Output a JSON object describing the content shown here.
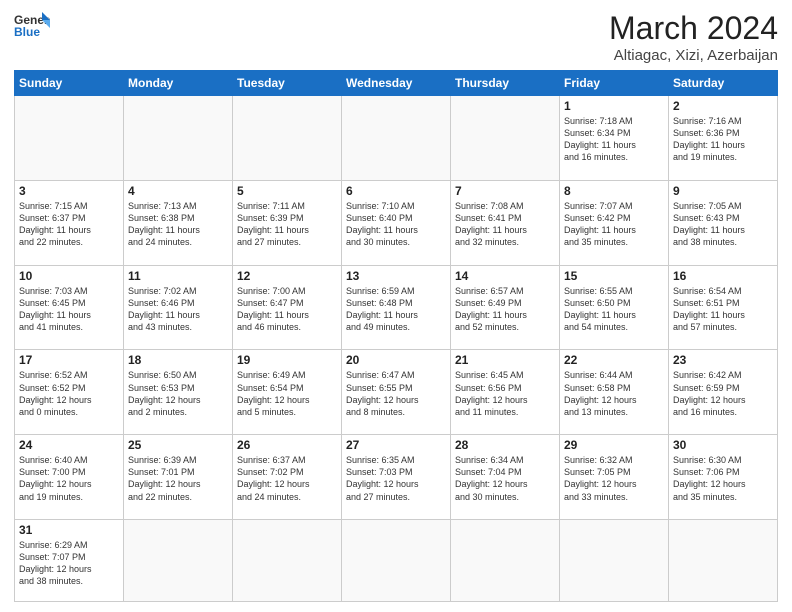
{
  "header": {
    "logo_general": "General",
    "logo_blue": "Blue",
    "title": "March 2024",
    "location": "Altiagac, Xizi, Azerbaijan"
  },
  "weekdays": [
    "Sunday",
    "Monday",
    "Tuesday",
    "Wednesday",
    "Thursday",
    "Friday",
    "Saturday"
  ],
  "weeks": [
    [
      {
        "day": "",
        "info": ""
      },
      {
        "day": "",
        "info": ""
      },
      {
        "day": "",
        "info": ""
      },
      {
        "day": "",
        "info": ""
      },
      {
        "day": "",
        "info": ""
      },
      {
        "day": "1",
        "info": "Sunrise: 7:18 AM\nSunset: 6:34 PM\nDaylight: 11 hours\nand 16 minutes."
      },
      {
        "day": "2",
        "info": "Sunrise: 7:16 AM\nSunset: 6:36 PM\nDaylight: 11 hours\nand 19 minutes."
      }
    ],
    [
      {
        "day": "3",
        "info": "Sunrise: 7:15 AM\nSunset: 6:37 PM\nDaylight: 11 hours\nand 22 minutes."
      },
      {
        "day": "4",
        "info": "Sunrise: 7:13 AM\nSunset: 6:38 PM\nDaylight: 11 hours\nand 24 minutes."
      },
      {
        "day": "5",
        "info": "Sunrise: 7:11 AM\nSunset: 6:39 PM\nDaylight: 11 hours\nand 27 minutes."
      },
      {
        "day": "6",
        "info": "Sunrise: 7:10 AM\nSunset: 6:40 PM\nDaylight: 11 hours\nand 30 minutes."
      },
      {
        "day": "7",
        "info": "Sunrise: 7:08 AM\nSunset: 6:41 PM\nDaylight: 11 hours\nand 32 minutes."
      },
      {
        "day": "8",
        "info": "Sunrise: 7:07 AM\nSunset: 6:42 PM\nDaylight: 11 hours\nand 35 minutes."
      },
      {
        "day": "9",
        "info": "Sunrise: 7:05 AM\nSunset: 6:43 PM\nDaylight: 11 hours\nand 38 minutes."
      }
    ],
    [
      {
        "day": "10",
        "info": "Sunrise: 7:03 AM\nSunset: 6:45 PM\nDaylight: 11 hours\nand 41 minutes."
      },
      {
        "day": "11",
        "info": "Sunrise: 7:02 AM\nSunset: 6:46 PM\nDaylight: 11 hours\nand 43 minutes."
      },
      {
        "day": "12",
        "info": "Sunrise: 7:00 AM\nSunset: 6:47 PM\nDaylight: 11 hours\nand 46 minutes."
      },
      {
        "day": "13",
        "info": "Sunrise: 6:59 AM\nSunset: 6:48 PM\nDaylight: 11 hours\nand 49 minutes."
      },
      {
        "day": "14",
        "info": "Sunrise: 6:57 AM\nSunset: 6:49 PM\nDaylight: 11 hours\nand 52 minutes."
      },
      {
        "day": "15",
        "info": "Sunrise: 6:55 AM\nSunset: 6:50 PM\nDaylight: 11 hours\nand 54 minutes."
      },
      {
        "day": "16",
        "info": "Sunrise: 6:54 AM\nSunset: 6:51 PM\nDaylight: 11 hours\nand 57 minutes."
      }
    ],
    [
      {
        "day": "17",
        "info": "Sunrise: 6:52 AM\nSunset: 6:52 PM\nDaylight: 12 hours\nand 0 minutes."
      },
      {
        "day": "18",
        "info": "Sunrise: 6:50 AM\nSunset: 6:53 PM\nDaylight: 12 hours\nand 2 minutes."
      },
      {
        "day": "19",
        "info": "Sunrise: 6:49 AM\nSunset: 6:54 PM\nDaylight: 12 hours\nand 5 minutes."
      },
      {
        "day": "20",
        "info": "Sunrise: 6:47 AM\nSunset: 6:55 PM\nDaylight: 12 hours\nand 8 minutes."
      },
      {
        "day": "21",
        "info": "Sunrise: 6:45 AM\nSunset: 6:56 PM\nDaylight: 12 hours\nand 11 minutes."
      },
      {
        "day": "22",
        "info": "Sunrise: 6:44 AM\nSunset: 6:58 PM\nDaylight: 12 hours\nand 13 minutes."
      },
      {
        "day": "23",
        "info": "Sunrise: 6:42 AM\nSunset: 6:59 PM\nDaylight: 12 hours\nand 16 minutes."
      }
    ],
    [
      {
        "day": "24",
        "info": "Sunrise: 6:40 AM\nSunset: 7:00 PM\nDaylight: 12 hours\nand 19 minutes."
      },
      {
        "day": "25",
        "info": "Sunrise: 6:39 AM\nSunset: 7:01 PM\nDaylight: 12 hours\nand 22 minutes."
      },
      {
        "day": "26",
        "info": "Sunrise: 6:37 AM\nSunset: 7:02 PM\nDaylight: 12 hours\nand 24 minutes."
      },
      {
        "day": "27",
        "info": "Sunrise: 6:35 AM\nSunset: 7:03 PM\nDaylight: 12 hours\nand 27 minutes."
      },
      {
        "day": "28",
        "info": "Sunrise: 6:34 AM\nSunset: 7:04 PM\nDaylight: 12 hours\nand 30 minutes."
      },
      {
        "day": "29",
        "info": "Sunrise: 6:32 AM\nSunset: 7:05 PM\nDaylight: 12 hours\nand 33 minutes."
      },
      {
        "day": "30",
        "info": "Sunrise: 6:30 AM\nSunset: 7:06 PM\nDaylight: 12 hours\nand 35 minutes."
      }
    ],
    [
      {
        "day": "31",
        "info": "Sunrise: 6:29 AM\nSunset: 7:07 PM\nDaylight: 12 hours\nand 38 minutes."
      },
      {
        "day": "",
        "info": ""
      },
      {
        "day": "",
        "info": ""
      },
      {
        "day": "",
        "info": ""
      },
      {
        "day": "",
        "info": ""
      },
      {
        "day": "",
        "info": ""
      },
      {
        "day": "",
        "info": ""
      }
    ]
  ]
}
